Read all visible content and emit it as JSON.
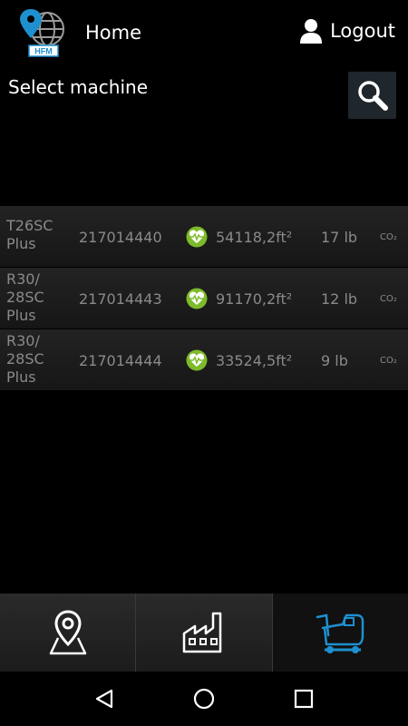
{
  "header": {
    "logo_text": "HFM",
    "home_label": "Home",
    "logout_label": "Logout"
  },
  "select_machine": {
    "label": "Select machine",
    "search_icon": "search-icon"
  },
  "machines": [
    {
      "name_line1": "T26SC",
      "name_line2": "Plus",
      "name_line3": "",
      "serial": "217014440",
      "area": "54118,2ft²",
      "weight": "17 lb",
      "co2": "CO₂",
      "status_icon": "health-icon"
    },
    {
      "name_line1": "R30/",
      "name_line2": "28SC",
      "name_line3": "Plus",
      "serial": "217014443",
      "area": "91170,2ft²",
      "weight": "12 lb",
      "co2": "CO₂",
      "status_icon": "health-icon"
    },
    {
      "name_line1": "R30/",
      "name_line2": "28SC",
      "name_line3": "Plus",
      "serial": "217014444",
      "area": "33524,5ft²",
      "weight": "9 lb",
      "co2": "CO₂",
      "status_icon": "health-icon"
    }
  ],
  "bottom_nav": [
    {
      "icon": "map-pin-icon",
      "active": false
    },
    {
      "icon": "factory-icon",
      "active": false
    },
    {
      "icon": "scrubber-machine-icon",
      "active": true
    }
  ],
  "colors": {
    "accent_blue": "#1e90d0",
    "health_green": "#7dbb2a",
    "text_gray": "#8a8a8a",
    "search_bg": "#1f262c"
  },
  "system_nav": {
    "back_icon": "back-icon",
    "home_icon": "home-circle-icon",
    "recents_icon": "recents-icon"
  }
}
